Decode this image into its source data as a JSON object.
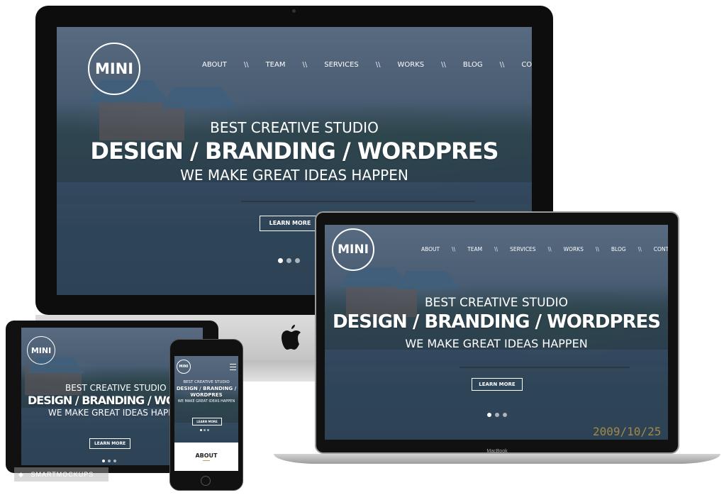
{
  "site": {
    "logo": "MINI",
    "nav": [
      "ABOUT",
      "TEAM",
      "SERVICES",
      "WORKS",
      "BLOG",
      "CONTACT"
    ],
    "nav_separator": "\\\\",
    "tagline_top": "BEST CREATIVE STUDIO",
    "headline": "DESIGN / BRANDING / WORDPRES",
    "tagline_bottom": "WE MAKE GREAT IDEAS HAPPEN",
    "cta": "LEARN MORE"
  },
  "laptop": {
    "brand": "MacBook",
    "photo_date": "2009/10/25"
  },
  "tablet": {
    "headline": "DESIGN / BRANDING / WORD"
  },
  "phone": {
    "headline_line1": "DESIGN / BRANDING /",
    "headline_line2": "WORDPRES",
    "section_title": "ABOUT"
  },
  "watermark": "SMARTMOCKUPS",
  "colors": {
    "overlay": "#2c3e56",
    "device_bezel": "#111111",
    "accent_gold": "#c8a040"
  }
}
